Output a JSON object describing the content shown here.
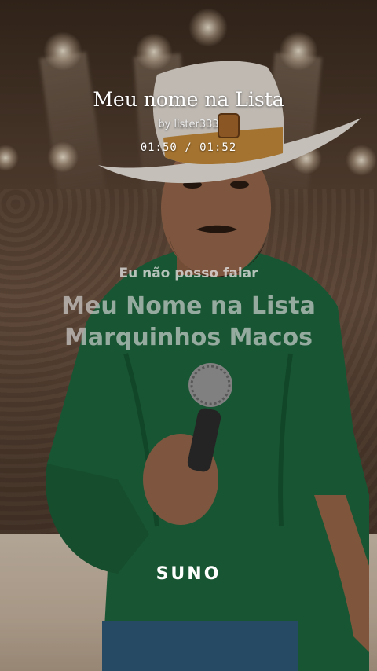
{
  "song": {
    "title": "Meu nome na Lista",
    "author": "by lister333",
    "time": "01:50 / 01:52"
  },
  "lyrics": {
    "previous_line": "Eu não posso falar",
    "current_line_1": "Meu Nome na Lista",
    "current_line_2": "Marquinhos Macos"
  },
  "brand": {
    "logo_text": "SUNO"
  },
  "colors": {
    "shirt": "#1e6a3f",
    "hat": "#e9e2d9",
    "text": "#ffffff"
  }
}
